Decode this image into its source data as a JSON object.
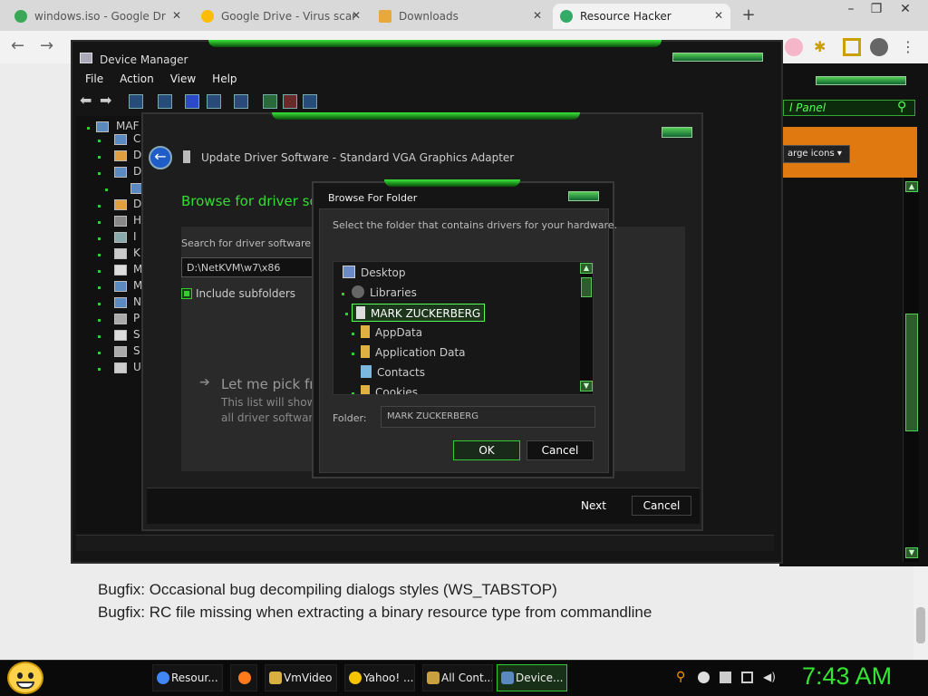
{
  "browser": {
    "tabs": [
      {
        "label": "windows.iso - Google Dr",
        "fav_color": "#3aa757"
      },
      {
        "label": "Google Drive - Virus scar",
        "fav_color": "#fbbc04"
      },
      {
        "label": "Downloads",
        "fav_color": "#e8a93c"
      },
      {
        "label": "Resource Hacker",
        "fav_color": "#3a6"
      }
    ],
    "tab_close_glyph": "✕",
    "new_tab_glyph": "+"
  },
  "page": {
    "bug_lines": [
      "Bugfix:  Occasional bug decompiling dialogs styles (WS_TABSTOP)",
      "Bugfix:  RC file missing when extracting a binary resource type from commandline"
    ]
  },
  "control_panel": {
    "search_text": "l Panel",
    "view_label": "arge icons ▾"
  },
  "device_manager": {
    "title": "Device Manager",
    "menu": [
      "File",
      "Action",
      "View",
      "Help"
    ],
    "tree_root": "MAF",
    "tree_letters": [
      "C",
      "D",
      "D",
      "",
      "D",
      "H",
      "I",
      "K",
      "M",
      "M",
      "N",
      "P",
      "S",
      "S",
      "U"
    ]
  },
  "update_driver": {
    "title": "Update Driver Software - Standard VGA Graphics Adapter",
    "heading": "Browse for driver sof",
    "search_label": "Search for driver software in",
    "path_value": "D:\\NetKVM\\w7\\x86",
    "include_subfolders": "Include subfolders",
    "pick_title": "Let me pick fro",
    "pick_desc": "This list will show all driver softwar",
    "next_label": "Next",
    "cancel_label": "Cancel"
  },
  "browse_folder": {
    "title": "Browse For Folder",
    "instruction": "Select the folder that contains drivers for your hardware.",
    "items": [
      {
        "label": "Desktop"
      },
      {
        "label": "Libraries"
      },
      {
        "label": "MARK ZUCKERBERG",
        "selected": true
      },
      {
        "label": "AppData"
      },
      {
        "label": "Application Data"
      },
      {
        "label": "Contacts"
      },
      {
        "label": "Cookies"
      }
    ],
    "folder_label": "Folder:",
    "folder_value": "MARK ZUCKERBERG",
    "ok_label": "OK",
    "cancel_label": "Cancel"
  },
  "taskbar": {
    "items": [
      {
        "label": "Resour...",
        "icon_color": "#4285f4"
      },
      {
        "label": "",
        "icon_color": "#ff7a1a"
      },
      {
        "label": "VmVideo",
        "icon_color": "#d8b040"
      },
      {
        "label": "Yahoo! ...",
        "icon_color": "#f5c400"
      },
      {
        "label": "All Cont...",
        "icon_color": "#c8a040"
      },
      {
        "label": "Device...",
        "icon_color": "#5a8ac0",
        "active": true
      }
    ],
    "clock": "7:43 AM"
  }
}
